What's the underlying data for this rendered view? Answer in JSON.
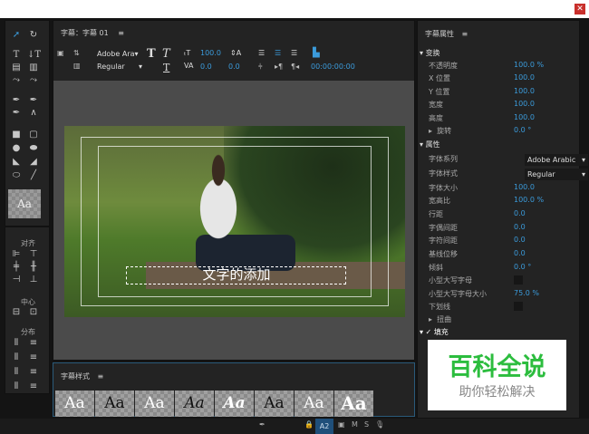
{
  "window": {
    "close_icon": "close-icon"
  },
  "tools": {
    "text_label": "Aa",
    "align_label": "对齐",
    "center_label": "中心",
    "distribute_label": "分布"
  },
  "title_panel": {
    "title": "字幕：字幕 01",
    "menu": "≡"
  },
  "toolbar": {
    "font_family": "Adobe Ara▾",
    "font_style": "Regular",
    "font_size": "100.0",
    "kerning": "0.0",
    "leading": "0.0",
    "timecode": "00:00:00:00"
  },
  "canvas": {
    "subtitle_text": "文字的添加"
  },
  "styles_panel": {
    "title": "字幕样式",
    "menu": "≡",
    "swatches": [
      "Aa",
      "Aa",
      "Aa",
      "Aa",
      "Aa",
      "Aa",
      "Aa",
      "Aa"
    ]
  },
  "properties": {
    "title": "字幕属性",
    "menu": "≡",
    "transform_group": "变换",
    "transform": [
      {
        "label": "不透明度",
        "value": "100.0 %"
      },
      {
        "label": "X 位置",
        "value": "100.0"
      },
      {
        "label": "Y 位置",
        "value": "100.0"
      },
      {
        "label": "宽度",
        "value": "100.0"
      },
      {
        "label": "高度",
        "value": "100.0"
      },
      {
        "label": "旋转",
        "value": "0.0 °"
      }
    ],
    "attributes_group": "属性",
    "font_family_label": "字体系列",
    "font_family": "Adobe Arabic",
    "font_style_label": "字体样式",
    "font_style": "Regular",
    "attributes": [
      {
        "label": "字体大小",
        "value": "100.0"
      },
      {
        "label": "宽高比",
        "value": "100.0 %"
      },
      {
        "label": "行距",
        "value": "0.0"
      },
      {
        "label": "字偶间距",
        "value": "0.0"
      },
      {
        "label": "字符间距",
        "value": "0.0"
      },
      {
        "label": "基线位移",
        "value": "0.0"
      },
      {
        "label": "倾斜",
        "value": "0.0 °"
      }
    ],
    "small_caps_label": "小型大写字母",
    "small_caps_size_label": "小型大写字母大小",
    "small_caps_size": "75.0 %",
    "underline_label": "下划线",
    "distort_label": "扭曲",
    "fill_label": "填充"
  },
  "watermark": {
    "title": "百科全说",
    "subtitle": "助你轻松解决"
  },
  "timeline": {
    "track": "A2",
    "m": "M",
    "s": "S"
  }
}
